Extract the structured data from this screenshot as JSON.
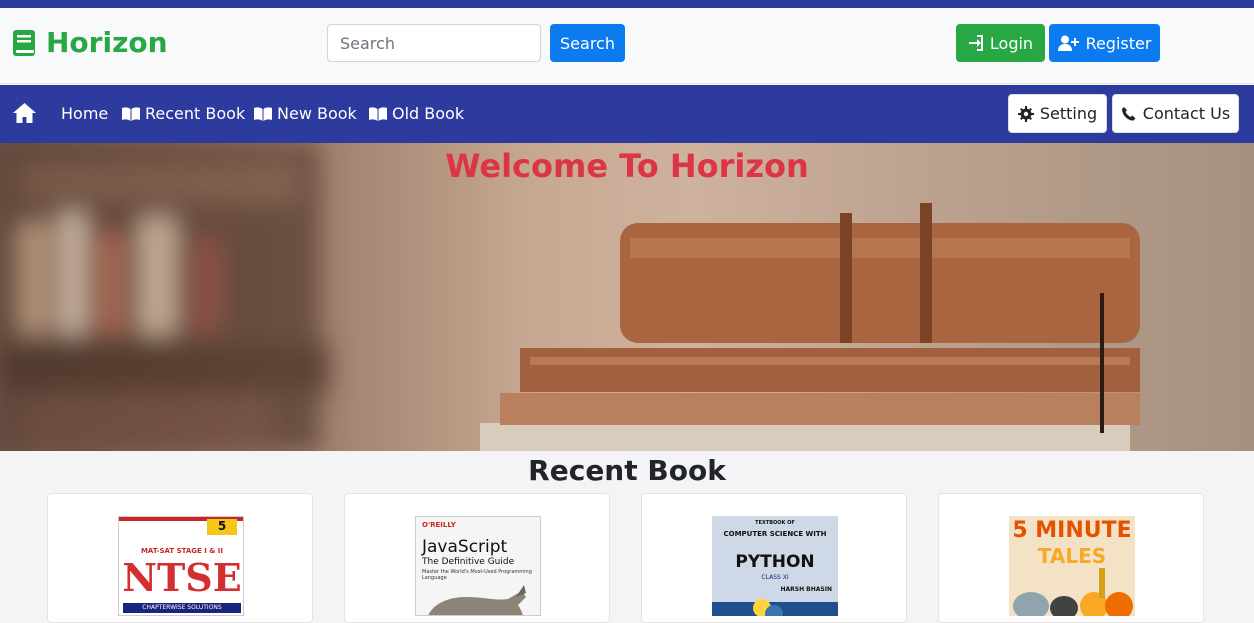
{
  "header": {
    "brand": "Horizon",
    "search_placeholder": "Search",
    "search_button": "Search",
    "login_button": "Login",
    "register_button": "Register"
  },
  "nav": {
    "links": [
      "Home",
      "Recent Book",
      "New Book",
      "Old Book"
    ],
    "setting": "Setting",
    "contact": "Contact Us"
  },
  "hero": {
    "title": "Welcome To Horizon"
  },
  "section": {
    "title": "Recent Book"
  },
  "books": [
    {
      "cover_lines": [
        "5",
        "MAT-SAT STAGE I & II",
        "NTSE",
        "CHAPTERWISE SOLUTIONS"
      ]
    },
    {
      "cover_lines": [
        "O'REILLY",
        "JavaScript",
        "The Definitive Guide",
        "Master the World's Most-Used Programming Language"
      ]
    },
    {
      "cover_lines": [
        "TEXTBOOK OF",
        "COMPUTER SCIENCE WITH",
        "PYTHON",
        "CLASS XI",
        "HARSH BHASIN"
      ]
    },
    {
      "cover_lines": [
        "5 MINUTE",
        "TALES"
      ]
    }
  ],
  "colors": {
    "brand": "#28a745",
    "nav": "#2d3a9e",
    "primary": "#0d7bf0",
    "hero_title": "#dc3545"
  }
}
